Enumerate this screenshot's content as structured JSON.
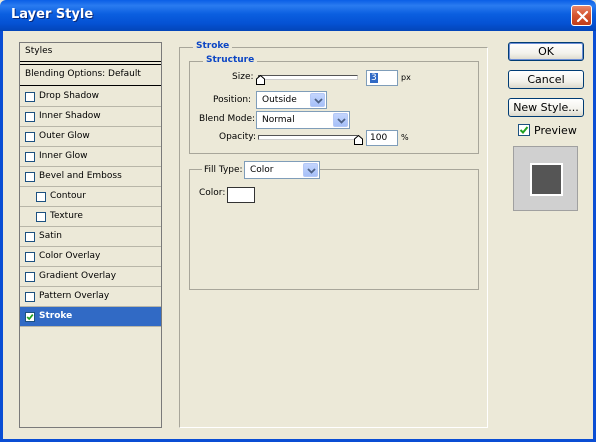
{
  "window": {
    "title": "Layer Style"
  },
  "styles_list": {
    "header": "Styles",
    "blending_options": "Blending Options: Default",
    "items": [
      {
        "label": "Drop Shadow",
        "checked": false,
        "indent": false,
        "selected": false
      },
      {
        "label": "Inner Shadow",
        "checked": false,
        "indent": false,
        "selected": false
      },
      {
        "label": "Outer Glow",
        "checked": false,
        "indent": false,
        "selected": false
      },
      {
        "label": "Inner Glow",
        "checked": false,
        "indent": false,
        "selected": false
      },
      {
        "label": "Bevel and Emboss",
        "checked": false,
        "indent": false,
        "selected": false
      },
      {
        "label": "Contour",
        "checked": false,
        "indent": true,
        "selected": false
      },
      {
        "label": "Texture",
        "checked": false,
        "indent": true,
        "selected": false
      },
      {
        "label": "Satin",
        "checked": false,
        "indent": false,
        "selected": false
      },
      {
        "label": "Color Overlay",
        "checked": false,
        "indent": false,
        "selected": false
      },
      {
        "label": "Gradient Overlay",
        "checked": false,
        "indent": false,
        "selected": false
      },
      {
        "label": "Pattern Overlay",
        "checked": false,
        "indent": false,
        "selected": false
      },
      {
        "label": "Stroke",
        "checked": true,
        "indent": false,
        "selected": true
      }
    ]
  },
  "stroke": {
    "group_title": "Stroke",
    "structure_title": "Structure",
    "size_label": "Size:",
    "size_value": "3",
    "size_unit": "px",
    "size_slider_fraction": 0.02,
    "position_label": "Position:",
    "position_value": "Outside",
    "blend_mode_label": "Blend Mode:",
    "blend_mode_value": "Normal",
    "opacity_label": "Opacity:",
    "opacity_value": "100",
    "opacity_unit": "%",
    "opacity_slider_fraction": 1.0,
    "fill_type_label": "Fill Type:",
    "fill_type_value": "Color",
    "color_label": "Color:",
    "color_value": "#ffffff"
  },
  "buttons": {
    "ok": "OK",
    "cancel": "Cancel",
    "new_style": "New Style...",
    "preview_label": "Preview",
    "preview_checked": true
  },
  "colors": {
    "accent_title": "#0c46c4",
    "selection": "#316ac5",
    "titlebar": "#0552d4"
  }
}
